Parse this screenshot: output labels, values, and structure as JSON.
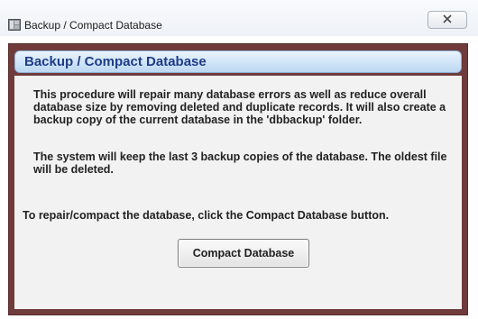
{
  "window": {
    "title": "Backup / Compact Database",
    "close_glyph": "✕"
  },
  "dialog": {
    "header": "Backup / Compact Database",
    "paragraphs": [
      "This procedure will repair many database errors as well as reduce overall database size by removing deleted and duplicate records. It will also create a backup copy of the current database in the 'dbbackup' folder.",
      "The system will keep the last 3 backup copies of the database. The oldest file will be deleted.",
      "To repair/compact the database, click the Compact Database button."
    ],
    "compact_button_label": "Compact Database"
  },
  "colors": {
    "frame": "#6f3b3b",
    "header_text": "#1f3c87",
    "panel": "#f2f2f2"
  },
  "icons": {
    "app": "database-app-icon",
    "close": "close-icon"
  }
}
